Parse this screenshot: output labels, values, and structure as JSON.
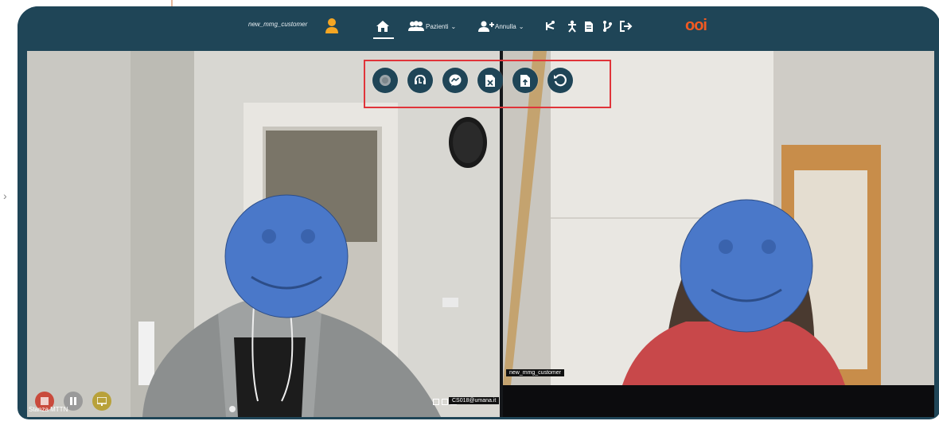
{
  "navbar": {
    "username": "new_mmg_customer",
    "items": [
      {
        "name": "home",
        "label": ""
      },
      {
        "name": "pazienti",
        "label": "Pazienti"
      },
      {
        "name": "annulla",
        "label": "Annulla"
      }
    ],
    "logo_text": "ooi"
  },
  "toolbar": {
    "buttons": [
      "record-icon",
      "headset-icon",
      "messenger-icon",
      "document-x-icon",
      "document-upload-icon",
      "reset-icon"
    ]
  },
  "left_video": {
    "caption": "CS018@umana.it",
    "bottom_label": "Stanza MTTN"
  },
  "right_video": {
    "caption": "new_mmg_customer"
  },
  "colors": {
    "navbar": "#1f4557",
    "highlight_box": "#e0343a",
    "logo": "#f15a22",
    "smiley": "#4a78c9"
  }
}
